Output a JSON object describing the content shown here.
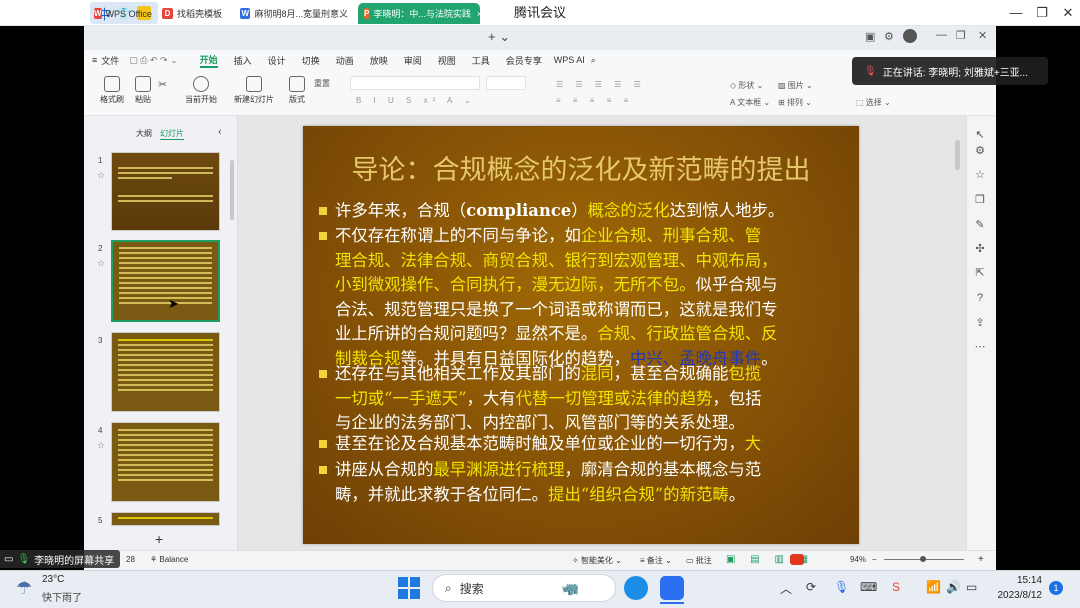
{
  "meeting": {
    "title": "腾讯会议",
    "ime_char": "中",
    "speaking_label": "正在讲话: 李晓明; 刘雅斌+三亚...",
    "screen_share_label": "李晓明的屏幕共享"
  },
  "wps": {
    "tabs": [
      {
        "label": "WPS Office",
        "icon": "W",
        "color": "#e5443c"
      },
      {
        "label": "找稻壳模板",
        "icon": "D",
        "color": "#e5443c"
      },
      {
        "label": "麻彻明8月...宽量刑意义",
        "icon": "W",
        "color": "#2f6fe4"
      },
      {
        "label": "李晓明：中...与法院实践",
        "icon": "P",
        "color": "#e66a2c"
      }
    ],
    "menu": [
      "文件",
      "开始",
      "插入",
      "设计",
      "切换",
      "动画",
      "放映",
      "审阅",
      "视图",
      "工具",
      "会员专享",
      "WPS AI"
    ],
    "ribbon": {
      "format_painter": "格式刷",
      "paste": "粘贴",
      "from_current": "当前开始",
      "new_slide": "新建幻灯片",
      "layout": "版式",
      "reset": "重置",
      "shape": "形状",
      "picture": "图片",
      "textbox": "文本框",
      "arrange": "排列",
      "select": "选择"
    },
    "panel_tabs": {
      "outline": "大纲",
      "slides": "幻灯片"
    },
    "slide_numbers": [
      "1",
      "2",
      "3",
      "4",
      "5"
    ],
    "status": {
      "slide_count": "28",
      "theme": "Balance",
      "smart_beautify": "智能美化",
      "notes": "备注",
      "comments": "批注",
      "zoom": "94%"
    }
  },
  "slide": {
    "title": "导论：合规概念的泛化及新范畴的提出",
    "p1": {
      "a": "许多年来，合规（",
      "b": "compliance",
      "c": "）",
      "d": "概念的泛化",
      "e": "达到惊人地步。"
    },
    "p2": {
      "l1a": "不仅存在称谓上的不同与争论，如",
      "l1b": "企业合规、刑事合规、管",
      "l2a": "理合规、法律合规、商贸合规、银行到宏观管理、中观布局，",
      "l3a": "小到微观操作、合同执行，漫无边际，无所不包。",
      "l3b": "似乎合规与",
      "l4": "合法、规范管理只是换了一个词语或称谓而已，这就是我们专",
      "l5a": "业上所讲的合规问题吗？显然不是。",
      "l5b": "合规、行政监管合规、反",
      "l6a": "制裁合规",
      "l6b": "等。并具有日益国际化的趋势，",
      "l6c": "中兴、孟晚舟事件",
      "l6d": "。"
    },
    "p3": {
      "l1a": "还存在与其他相关工作及其部门的",
      "l1b": "混同",
      "l1c": "，甚至合规确能",
      "l1d": "包揽",
      "l2a": "一切或“一手遮天”",
      "l2b": "，大有",
      "l2c": "代替一切管理或法律的趋势",
      "l2d": "，包括",
      "l3": "与企业的法务部门、内控部门、风管部门等的关系处理。"
    },
    "p4": {
      "a": "甚至在论及合规基本范畴时触及单位或企业的一切行为，",
      "b": "大"
    },
    "p5": {
      "l1a": "讲座从合规的",
      "l1b": "最早渊源进行梳理",
      "l1c": "，廓清合规的基本概念与范",
      "l2a": "畴，并就此求教于各位同仁。",
      "l2b": "提出“组织合规”的新范畴",
      "l2c": "。"
    }
  },
  "taskbar": {
    "weather_temp": "23°C",
    "weather_desc": "快下雨了",
    "search_placeholder": "搜索",
    "time": "15:14",
    "date": "2023/8/12",
    "notification_count": "1"
  }
}
